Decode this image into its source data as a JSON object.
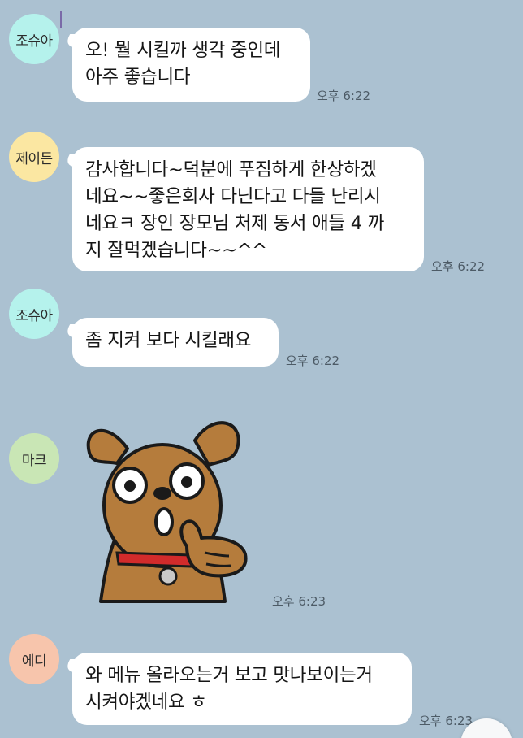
{
  "colors": {
    "background": "#abc1d1",
    "bubble": "#ffffff",
    "avatar_josua": "#b5f2ec",
    "avatar_jaden": "#fbe7a2",
    "avatar_mark": "#c9e6b5",
    "avatar_eddie": "#f7c5ac"
  },
  "messages": [
    {
      "sender": "조슈아",
      "text": "오! 뭘 시킬까 생각 중인데\n아주 좋습니다",
      "time": "오후 6:22"
    },
    {
      "sender": "제이든",
      "text": "감사합니다~덕분에 푸짐하게 한상하겠\n네요~~좋은회사 다닌다고 다들 난리시\n네요ㅋ 장인 장모님 처제 동서 애들 4 까\n지 잘먹겠습니다~~^^",
      "time": "오후 6:22"
    },
    {
      "sender": "조슈아",
      "text": "좀 지켜 보다 시킬래요",
      "time": "오후 6:22"
    },
    {
      "sender": "마크",
      "sticker": "dog-thumbs-up-sticker",
      "time": "오후 6:23"
    },
    {
      "sender": "에디",
      "text": "와 메뉴 올라오는거 보고 맛나보이는거\n시켜야겠네요 ㅎ",
      "time": "오후 6:23"
    }
  ]
}
